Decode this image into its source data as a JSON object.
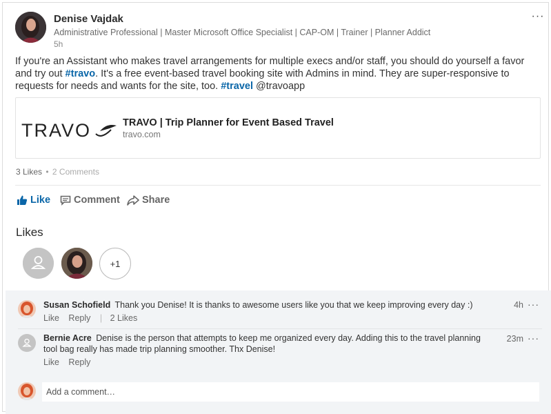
{
  "post": {
    "author": {
      "name": "Denise Vajdak",
      "headline": "Administrative Professional | Master Microsoft Office Specialist | CAP-OM | Trainer | Planner Addict",
      "time": "5h"
    },
    "more_label": "···",
    "text_parts": {
      "p1": "If you're an Assistant who makes travel arrangements for multiple execs and/or staff, you should do yourself a favor and try out ",
      "tag1": "#travo",
      "p2": ".  It's a free event-based travel booking site with Admins in mind.  They are super-responsive to requests for needs and wants for the site, too. ",
      "tag2": "#travel",
      "p3": " @travoapp"
    },
    "link_preview": {
      "logo_text": "TRAVO",
      "title": "TRAVO | Trip Planner for Event Based Travel",
      "domain": "travo.com"
    },
    "counts": {
      "likes": "3 Likes",
      "separator": "•",
      "comments": "2 Comments"
    },
    "actions": {
      "like": "Like",
      "comment": "Comment",
      "share": "Share"
    },
    "likes_section": {
      "heading": "Likes",
      "more_count": "+1"
    }
  },
  "comments": [
    {
      "author": "Susan Schofield",
      "text": "Thank you Denise! It is thanks to awesome users like you that we keep improving every day :)",
      "time": "4h",
      "like_label": "Like",
      "reply_label": "Reply",
      "likes_count": "2 Likes"
    },
    {
      "author": "Bernie Acre",
      "text": "Denise is the person that attempts to keep me organized every day.  Adding this to the travel planning tool bag really has made trip planning smoother.  Thx Denise!",
      "time": "23m",
      "like_label": "Like",
      "reply_label": "Reply"
    }
  ],
  "add_comment": {
    "placeholder": "Add a comment…"
  },
  "colors": {
    "accent": "#0a66a8",
    "comments_bg": "#f2f4f6"
  }
}
